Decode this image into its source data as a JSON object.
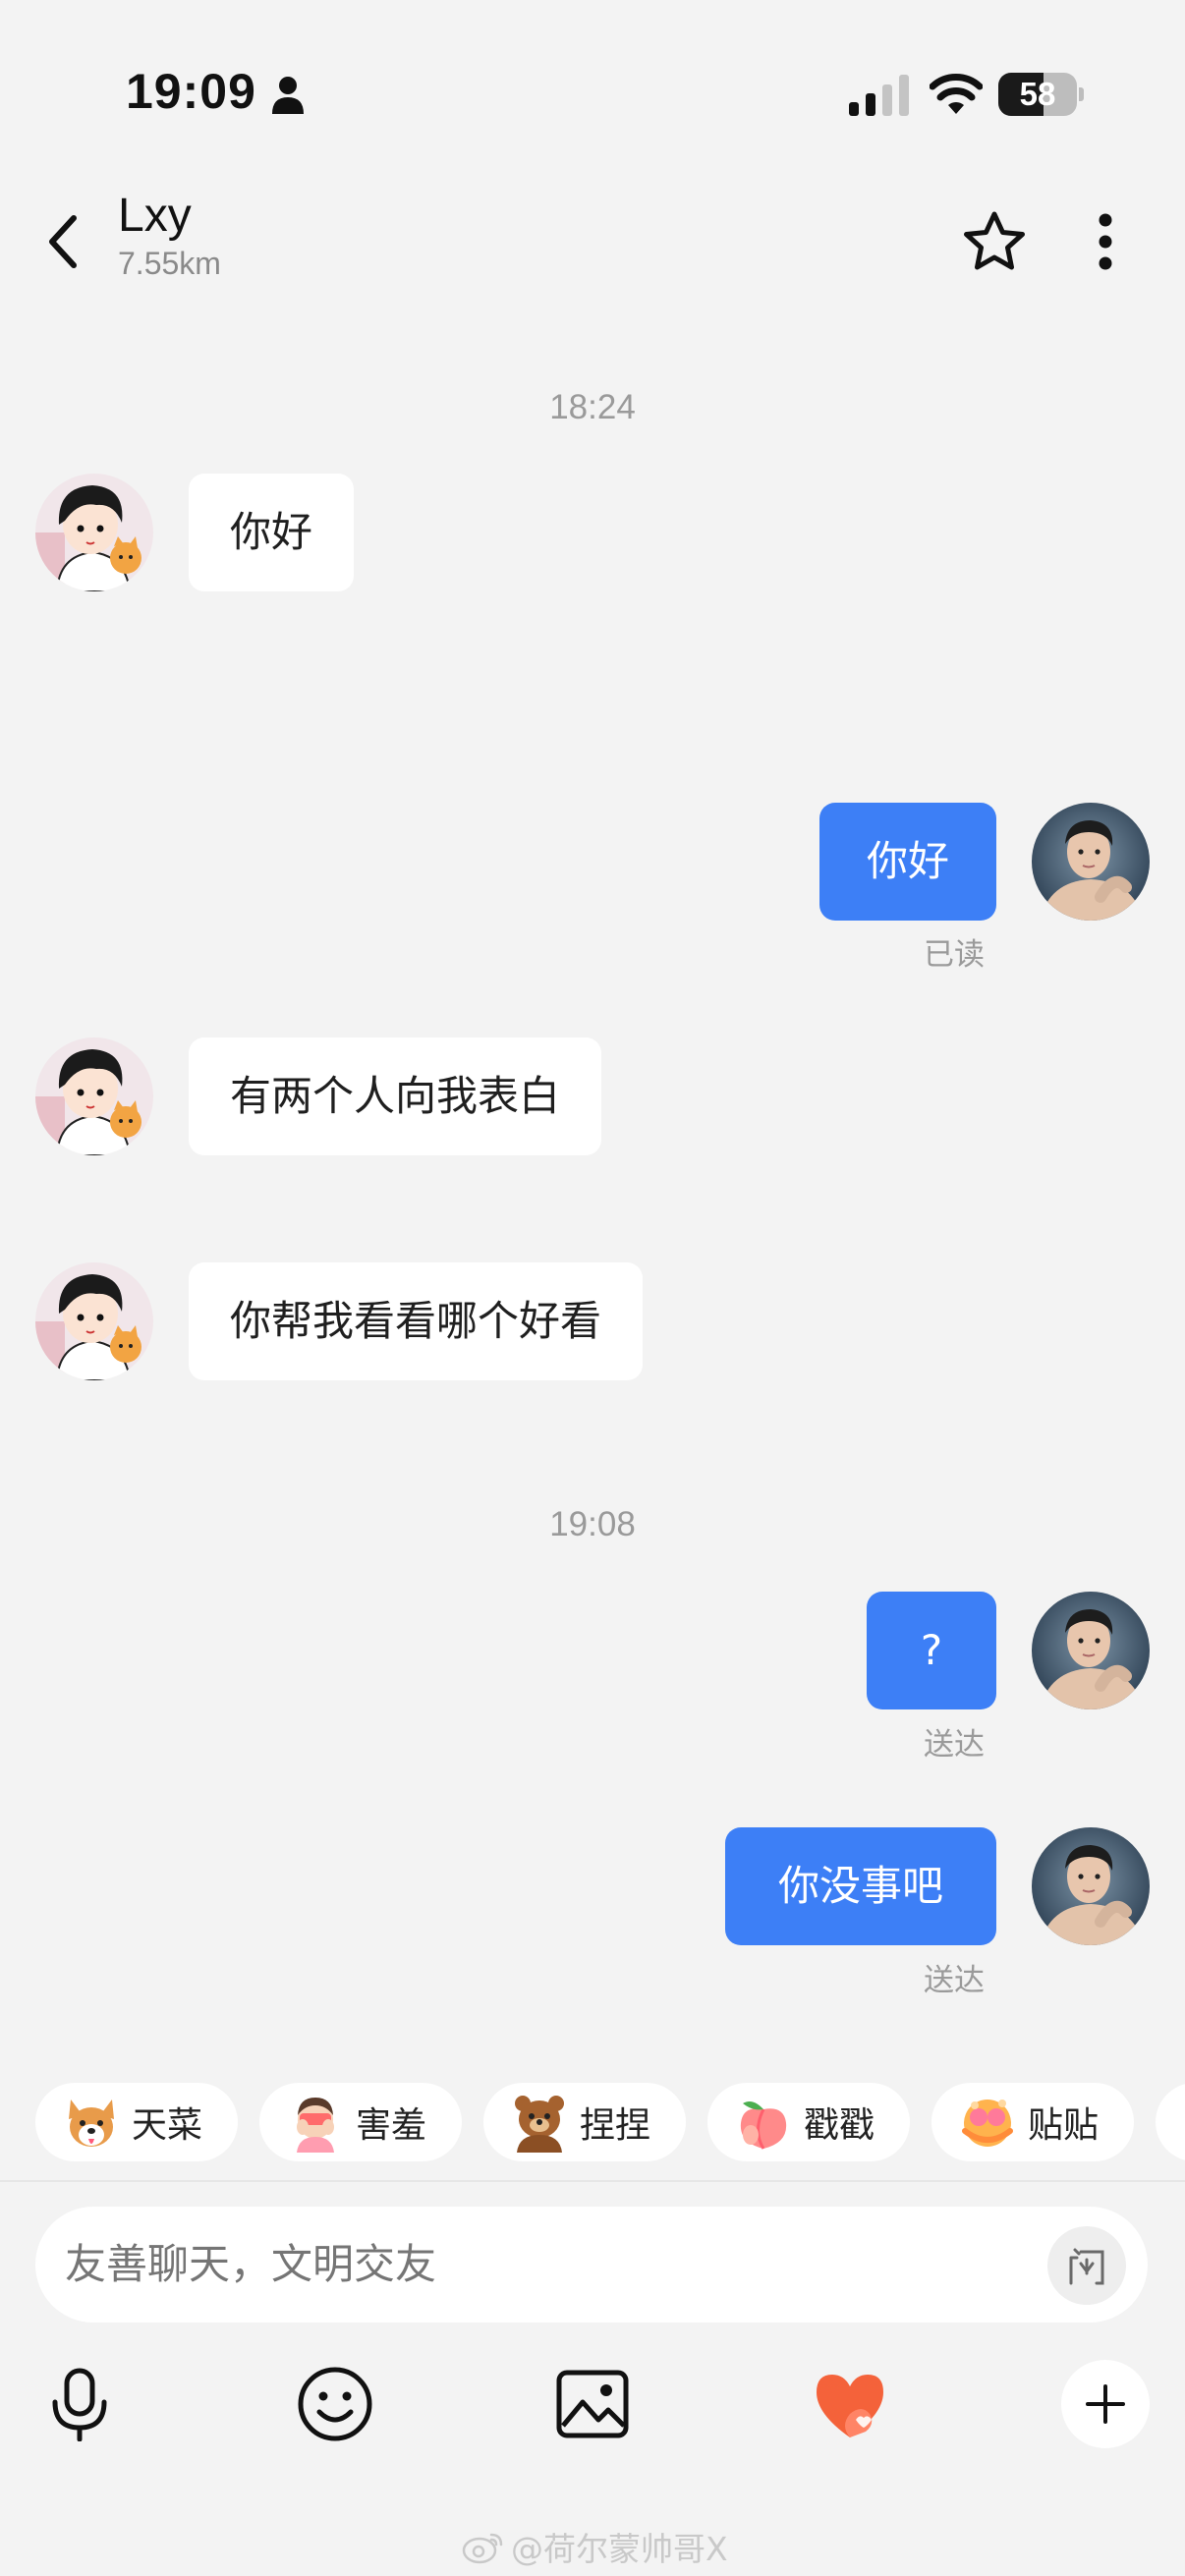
{
  "status_bar": {
    "time": "19:09",
    "battery_percent": "58",
    "battery_level": 0.58,
    "icons": [
      "person-icon",
      "signal-icon",
      "wifi-icon",
      "battery-icon"
    ]
  },
  "header": {
    "name": "Lxy",
    "distance": "7.55km",
    "icons": [
      "back-chevron-icon",
      "star-icon",
      "more-vertical-icon"
    ]
  },
  "chat": {
    "timestamps": [
      "18:24",
      "19:08"
    ],
    "messages": [
      {
        "side": "in",
        "text": "你好"
      },
      {
        "side": "out",
        "text": "你好",
        "status": "已读"
      },
      {
        "side": "in",
        "text": "有两个人向我表白"
      },
      {
        "side": "in",
        "text": "你帮我看看哪个好看"
      },
      {
        "side": "out",
        "text": "?",
        "status": "送达"
      },
      {
        "side": "out",
        "text": "你没事吧",
        "status": "送达"
      }
    ]
  },
  "stickers": [
    {
      "label": "天菜",
      "icon": "corgi-icon"
    },
    {
      "label": "害羞",
      "icon": "shy-icon"
    },
    {
      "label": "捏捏",
      "icon": "bear-icon"
    },
    {
      "label": "戳戳",
      "icon": "peach-icon"
    },
    {
      "label": "贴贴",
      "icon": "hug-icon"
    }
  ],
  "input": {
    "placeholder": "友善聊天，文明交友",
    "flash_label": "闪"
  },
  "toolbar": {
    "icons": [
      "microphone-icon",
      "emoji-icon",
      "image-icon",
      "heart-gift-icon",
      "plus-icon"
    ]
  },
  "watermark": {
    "text": "@荷尔蒙帅哥X",
    "icon": "weibo-icon"
  },
  "colors": {
    "background": "#f3f3f3",
    "outgoing_bubble": "#3d7ff6",
    "incoming_bubble": "#ffffff",
    "heart": "#f4623a"
  }
}
